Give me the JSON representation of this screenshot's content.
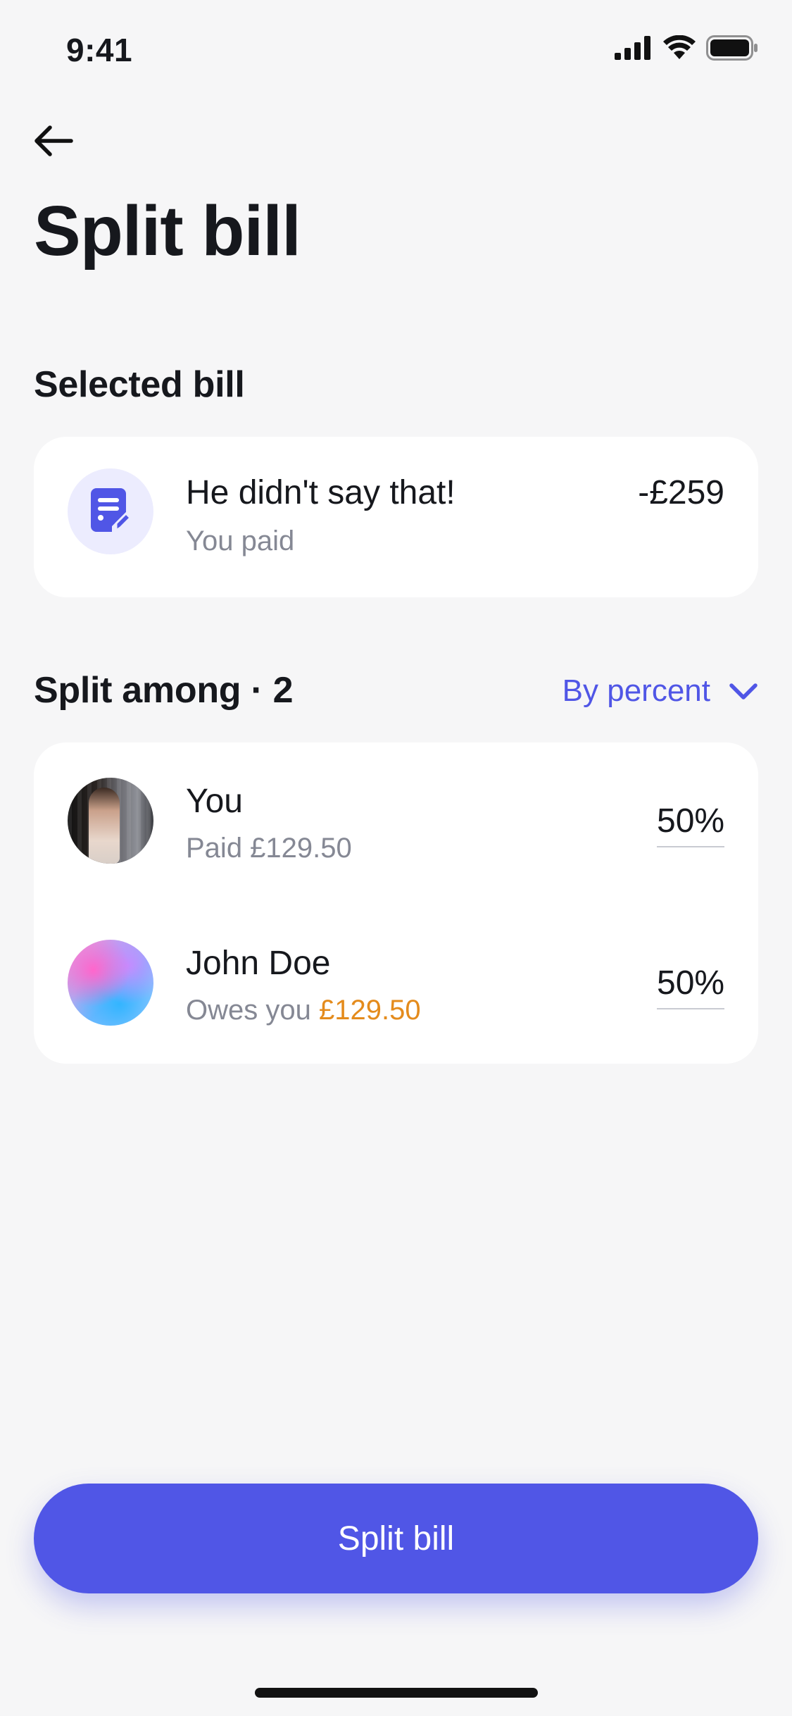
{
  "status_bar": {
    "time": "9:41"
  },
  "header": {
    "title": "Split bill"
  },
  "selected_bill": {
    "section_label": "Selected bill",
    "title": "He didn't say that!",
    "subtitle": "You paid",
    "amount": "-£259"
  },
  "split": {
    "section_label": "Split among · 2",
    "method": "By percent",
    "people": [
      {
        "name": "You",
        "status_text": "Paid £129.50",
        "percent": "50%"
      },
      {
        "name": "John Doe",
        "status_prefix": "Owes you",
        "amount_owed": "£129.50",
        "percent": "50%"
      }
    ]
  },
  "actions": {
    "primary_label": "Split bill"
  },
  "colors": {
    "accent": "#5056E6",
    "owed": "#E48B1C",
    "background": "#F6F6F7"
  },
  "icons": [
    "back-arrow-icon",
    "document-edit-icon",
    "chevron-down-icon",
    "cellular-signal-icon",
    "wifi-icon",
    "battery-icon"
  ]
}
